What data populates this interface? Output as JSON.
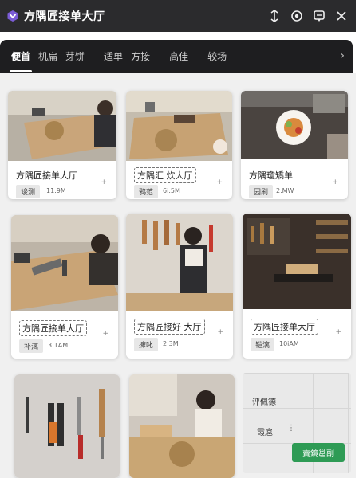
{
  "app": {
    "title": "方隅匠接单大厅"
  },
  "tabs": [
    "便首",
    "机扁",
    "芽饼",
    "适单",
    "方接",
    "高佳",
    "较场"
  ],
  "cards": [
    {
      "title": "方隅匠接单大厅",
      "tag": "竣测",
      "meta": "11.9M",
      "more": "+"
    },
    {
      "title": "方隅汇  炊大厅",
      "tag": "鸦范",
      "meta": "6i.5M",
      "more": "+"
    },
    {
      "title": "方隅瓊矯单",
      "tag": "园刷",
      "meta": "2.MW",
      "more": "+"
    },
    {
      "title": "方隅匠接单大厅",
      "tag": "补漓",
      "meta": "3.1AM",
      "more": "+"
    },
    {
      "title": "方隅匠接好  大厅",
      "tag": "擁叱",
      "meta": "2.3M",
      "more": "+"
    },
    {
      "title": "方隅匠接单大厅",
      "tag": "铠漓",
      "meta": "10iAM",
      "more": "+"
    }
  ],
  "panel": {
    "label1": "评佩德",
    "label2": "霞扈",
    "dots": "⋮",
    "button": "賣鏡邕副"
  },
  "colors": {
    "titlebar": "#2b2b2d",
    "tabbar": "#1e1e20",
    "accent": "#2e9b55"
  }
}
